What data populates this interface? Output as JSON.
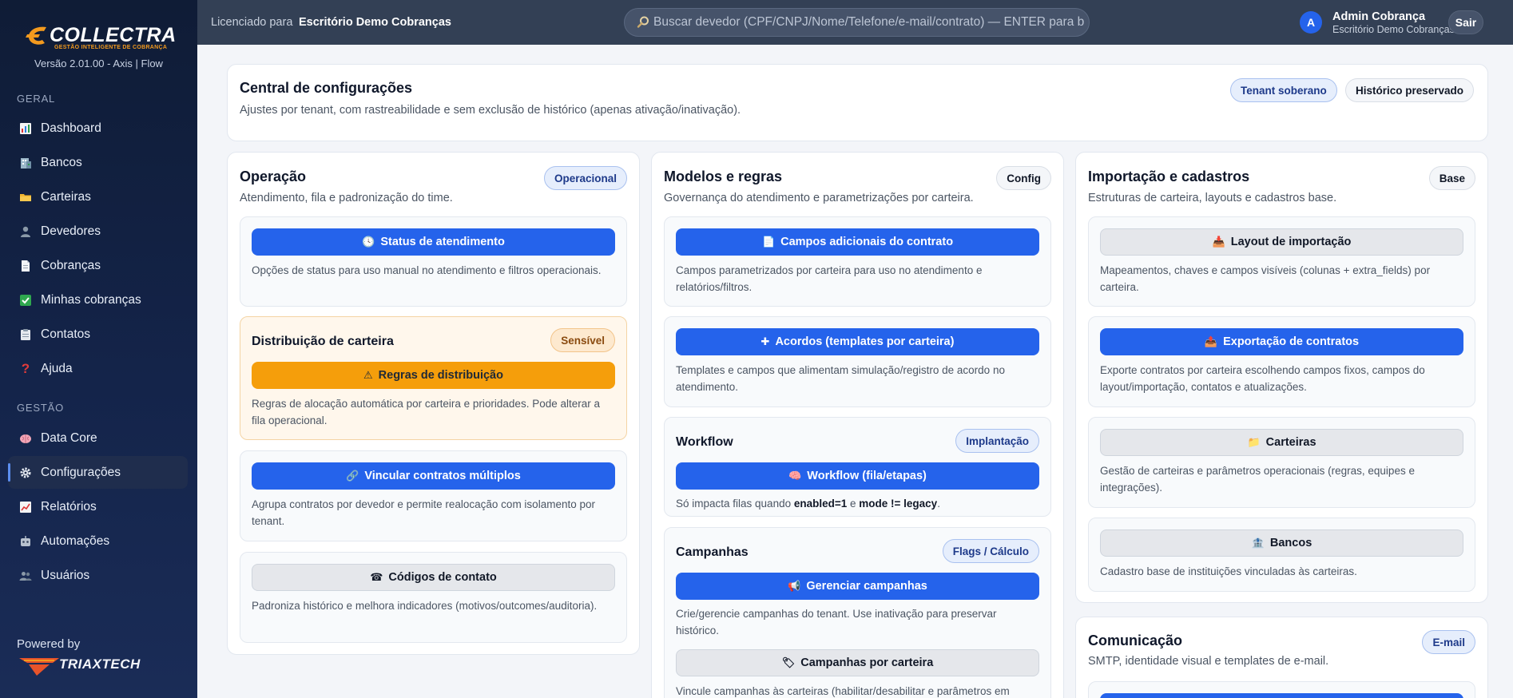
{
  "brand": {
    "logo_word": "COLLECTRA",
    "logo_tagline": "GESTÃO INTELIGENTE DE COBRANÇA",
    "version": "Versão 2.01.00 - Axis | Flow",
    "powered_by": "Powered by",
    "partner_word": "TRIAXTECH",
    "accent_color": "#f39a1e"
  },
  "sidebar": {
    "sections": [
      {
        "title": "GERAL",
        "items": [
          {
            "label": "Dashboard",
            "icon": "bar-chart-icon"
          },
          {
            "label": "Bancos",
            "icon": "bank-icon"
          },
          {
            "label": "Carteiras",
            "icon": "folder-icon"
          },
          {
            "label": "Devedores",
            "icon": "user-icon"
          },
          {
            "label": "Cobranças",
            "icon": "document-icon"
          },
          {
            "label": "Minhas cobranças",
            "icon": "check-icon"
          },
          {
            "label": "Contatos",
            "icon": "clipboard-icon"
          },
          {
            "label": "Ajuda",
            "icon": "question-icon"
          }
        ]
      },
      {
        "title": "GESTÃO",
        "items": [
          {
            "label": "Data Core",
            "icon": "brain-icon"
          },
          {
            "label": "Configurações",
            "icon": "gear-icon",
            "active": true
          },
          {
            "label": "Relatórios",
            "icon": "report-icon"
          },
          {
            "label": "Automações",
            "icon": "robot-icon"
          },
          {
            "label": "Usuários",
            "icon": "users-icon"
          }
        ]
      }
    ]
  },
  "topbar": {
    "license_label": "Licenciado para",
    "license_value": "Escritório Demo Cobranças",
    "search_placeholder": "Buscar devedor (CPF/CNPJ/Nome/Telefone/e-mail/contrato) — ENTER para buscar",
    "user_initial": "A",
    "user_name": "Admin Cobrança",
    "user_org": "Escritório Demo Cobranças",
    "logout_label": "Sair"
  },
  "header": {
    "title": "Central de configurações",
    "subtitle": "Ajustes por tenant, com rastreabilidade e sem exclusão de histórico (apenas ativação/inativação).",
    "badges": [
      "Tenant soberano",
      "Histórico preservado"
    ]
  },
  "columns": {
    "operacao": {
      "title": "Operação",
      "subtitle": "Atendimento, fila e padronização do time.",
      "badge": "Operacional",
      "items": [
        {
          "button": "Status de atendimento",
          "icon": "clock-icon",
          "desc": "Opções de status para uso manual no atendimento e filtros operacionais."
        },
        {
          "title": "Distribuição de carteira",
          "badge": "Sensível",
          "button": "Regras de distribuição",
          "icon": "warning-icon",
          "desc": "Regras de alocação automática por carteira e prioridades. Pode alterar a fila operacional."
        },
        {
          "button": "Vincular contratos múltiplos",
          "icon": "link-icon",
          "desc": "Agrupa contratos por devedor e permite realocação com isolamento por tenant."
        },
        {
          "button": "Códigos de contato",
          "icon": "phone-icon",
          "desc": "Padroniza histórico e melhora indicadores (motivos/outcomes/auditoria)."
        }
      ]
    },
    "modelos": {
      "title": "Modelos e regras",
      "subtitle": "Governança do atendimento e parametrizações por carteira.",
      "badge": "Config",
      "items": [
        {
          "button": "Campos adicionais do contrato",
          "icon": "memo-icon",
          "desc": "Campos parametrizados por carteira para uso no atendimento e relatórios/filtros."
        },
        {
          "button": "Acordos (templates por carteira)",
          "icon": "puzzle-icon",
          "desc": "Templates e campos que alimentam simulação/registro de acordo no atendimento."
        },
        {
          "title": "Workflow",
          "badge": "Implantação",
          "button": "Workflow (fila/etapas)",
          "icon": "brain-icon",
          "desc_prefix": "Só impacta filas quando ",
          "desc_code1": "enabled=1",
          "desc_mid": " e ",
          "desc_code2": "mode != legacy",
          "desc_suffix": "."
        },
        {
          "title": "Campanhas",
          "badge": "Flags / Cálculo",
          "button": "Gerenciar campanhas",
          "icon": "megaphone-icon",
          "desc": "Crie/gerencie campanhas do tenant. Use inativação para preservar histórico.",
          "button2": "Campanhas por carteira",
          "icon2": "tag-icon",
          "desc2": "Vincule campanhas às carteiras (habilitar/desabilitar e parâmetros em"
        }
      ]
    },
    "importacao": {
      "title": "Importação e cadastros",
      "subtitle": "Estruturas de carteira, layouts e cadastros base.",
      "badge": "Base",
      "items": [
        {
          "button": "Layout de importação",
          "icon": "inbox-icon",
          "desc": "Mapeamentos, chaves e campos visíveis (colunas + extra_fields) por carteira."
        },
        {
          "button": "Exportação de contratos",
          "icon": "outbox-icon",
          "desc": "Exporte contratos por carteira escolhendo campos fixos, campos do layout/importação, contatos e atualizações."
        },
        {
          "button": "Carteiras",
          "icon": "folder-icon",
          "desc": "Gestão de carteiras e parâmetros operacionais (regras, equipes e integrações)."
        },
        {
          "button": "Bancos",
          "icon": "bank-icon",
          "desc": "Cadastro base de instituições vinculadas às carteiras."
        }
      ]
    },
    "comunicacao": {
      "title": "Comunicação",
      "subtitle": "SMTP, identidade visual e templates de e-mail.",
      "badge": "E-mail"
    }
  }
}
